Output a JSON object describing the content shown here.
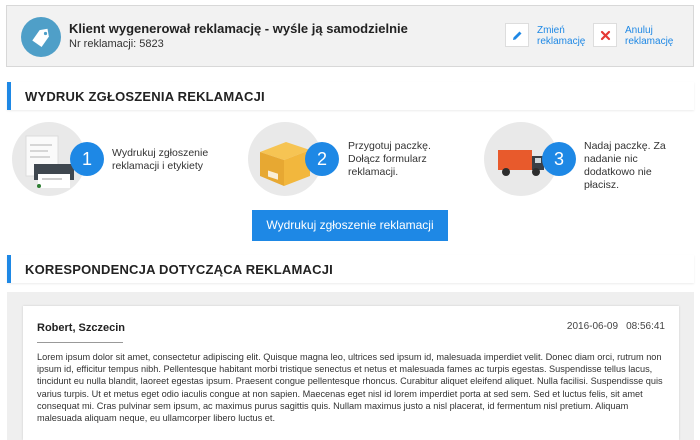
{
  "header": {
    "title": "Klient wygenerował reklamację - wyśle ją samodzielnie",
    "claim_label": "Nr reklamacji: 5823",
    "icon": "tag-icon",
    "actions": {
      "edit_label": "Zmień reklamację",
      "cancel_label": "Anuluj reklamację"
    }
  },
  "print_section": {
    "heading": "WYDRUK ZGŁOSZENIA REKLAMACJI",
    "steps": [
      {
        "number": "1",
        "text": "Wydrukuj zgłoszenie reklamacji i etykiety",
        "icon": "printer-icon"
      },
      {
        "number": "2",
        "text": "Przygotuj paczkę. Dołącz formularz reklamacji.",
        "icon": "package-icon"
      },
      {
        "number": "3",
        "text": "Nadaj paczkę. Za nadanie nic dodatkowo nie płacisz.",
        "icon": "truck-icon"
      }
    ],
    "print_button": "Wydrukuj zgłoszenie reklamacji"
  },
  "correspondence": {
    "heading": "KORESPONDENCJA DOTYCZĄCA REKLAMACJI",
    "messages": [
      {
        "author": "Robert, Szczecin",
        "date": "2016-06-09",
        "time": "08:56:41",
        "body": "Lorem ipsum dolor sit amet, consectetur adipiscing elit. Quisque magna leo, ultrices sed ipsum id, malesuada imperdiet velit. Donec diam orci, rutrum non ipsum id, efficitur tempus nibh. Pellentesque habitant morbi tristique senectus et netus et malesuada fames ac turpis egestas. Suspendisse tellus lacus, tincidunt eu nulla blandit, laoreet egestas ipsum. Praesent congue pellentesque rhoncus. Curabitur aliquet eleifend aliquet. Nulla facilisi. Suspendisse quis varius turpis. Ut et metus eget odio iaculis congue at non sapien. Maecenas eget nisl id lorem imperdiet porta at sed sem. Sed et luctus felis, sit amet consequat mi. Cras pulvinar sem ipsum, ac maximus purus sagittis quis. Nullam maximus justo a nisl placerat, id fermentum nisl pretium. Aliquam malesuada aliquam neque, eu ullamcorper libero luctus et."
      }
    ]
  },
  "colors": {
    "accent": "#1e88e5",
    "header_bg": "#f2f2f2",
    "tag_circle": "#4f9fc8",
    "cancel_red": "#e53935"
  }
}
